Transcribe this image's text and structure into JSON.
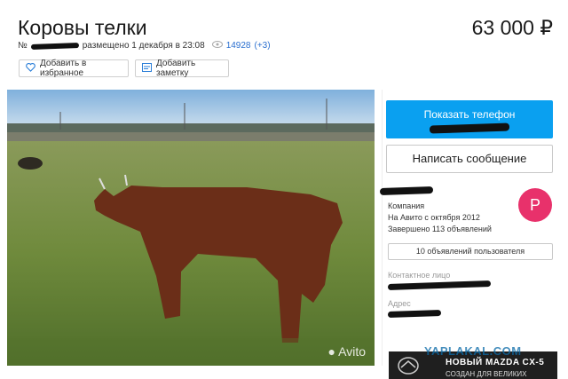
{
  "listing": {
    "title": "Коровы телки",
    "price": "63 000 ₽",
    "number_prefix": "№",
    "posted": "размещено 1 декабря в 23:08",
    "views": "14928",
    "views_new": "(+3)"
  },
  "actions": {
    "favorite_label": "Добавить в избранное",
    "note_label": "Добавить заметку"
  },
  "photo": {
    "watermark": "Avito"
  },
  "contact": {
    "phone_label": "Показать телефон",
    "message_label": "Написать сообщение",
    "seller_type": "Компания",
    "since": "На Авито с октября 2012",
    "completed": "Завершено 113 объявлений",
    "avatar_letter": "P",
    "user_ads_label": "10 объявлений пользователя",
    "contact_person_label": "Контактное лицо",
    "address_label": "Адрес"
  },
  "banner": {
    "text": "НОВЫЙ MAZDA CX-5",
    "subtext": "СОЗДАН ДЛЯ ВЕЛИКИХ"
  },
  "site_watermark": "YAPLAKAL.COM",
  "colors": {
    "accent": "#0aa0f0",
    "avatar": "#e8316b",
    "link": "#2a6fcf"
  }
}
